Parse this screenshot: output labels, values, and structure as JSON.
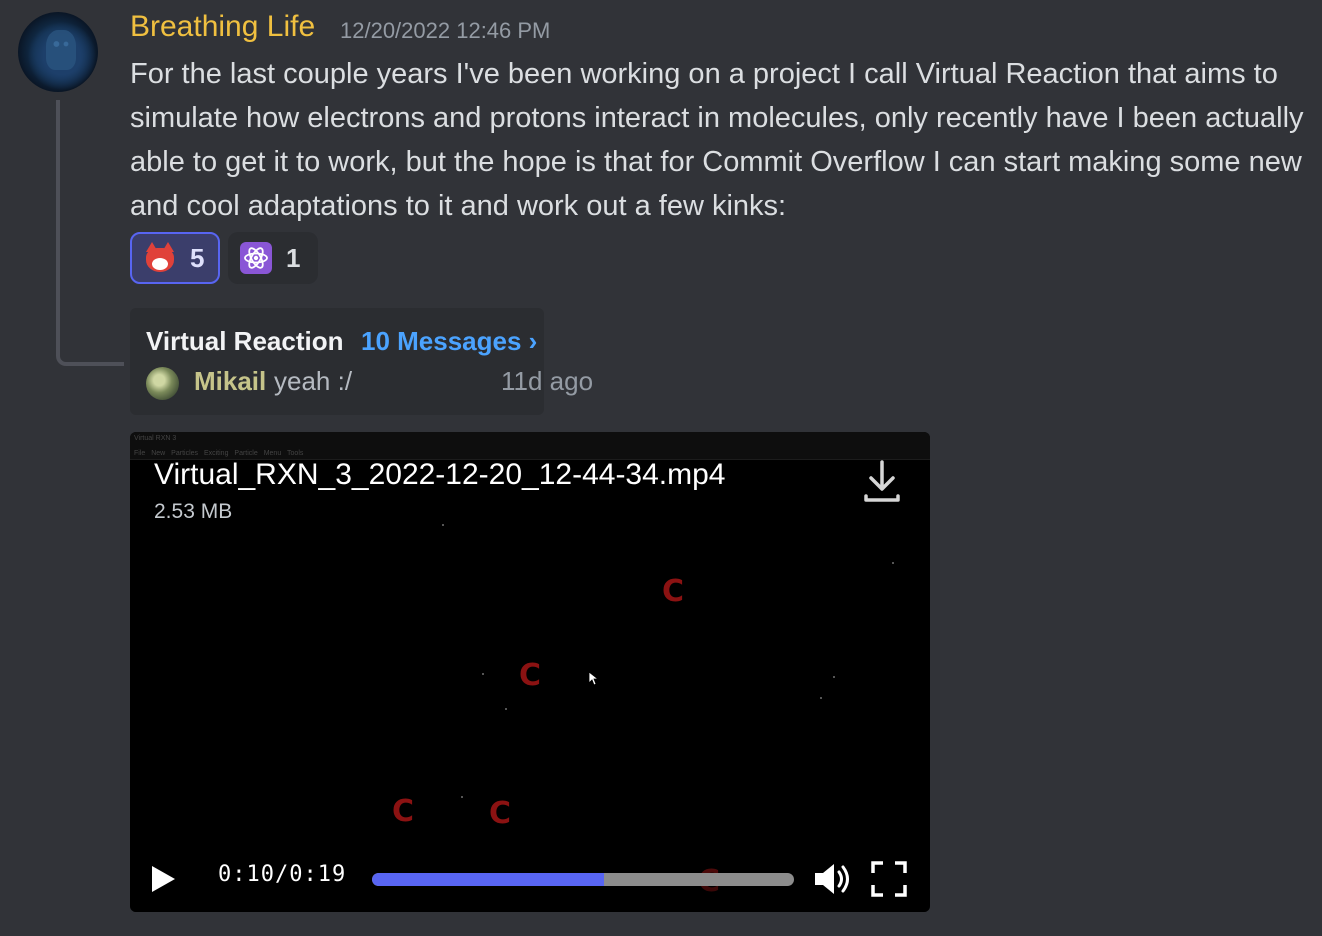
{
  "message": {
    "author": "Breathing Life",
    "author_color": "#f0c040",
    "timestamp": "12/20/2022 12:46 PM",
    "content": "For the last couple years I've been working on a project I call Virtual Reaction that aims to simulate how electrons and protons interact in molecules, only recently have I been actually able to get it to work, but the hope is that for Commit Overflow I can start making some new and cool adaptations to it and work out a few kinks:"
  },
  "reactions": [
    {
      "emoji": "fox-face-emoji",
      "count": "5",
      "reacted": true
    },
    {
      "emoji": "atom-emoji",
      "count": "1",
      "reacted": false
    }
  ],
  "thread": {
    "name": "Virtual Reaction",
    "message_count": "10 Messages ›",
    "last_author": "Mikail",
    "last_message": "yeah :/",
    "last_time": "11d ago"
  },
  "attachment": {
    "filename": "Virtual_RXN_3_2022-12-20_12-44-34.mp4",
    "size": "2.53 MB",
    "window_title": "Virtual RXN 3",
    "window_menu": "File  New Particles  Exciting Particle Menu  Tools",
    "particle_label": "C",
    "current_time": "0:10",
    "separator": "/",
    "duration": "0:19",
    "progress": 0.55,
    "accent": "#5865f2"
  }
}
